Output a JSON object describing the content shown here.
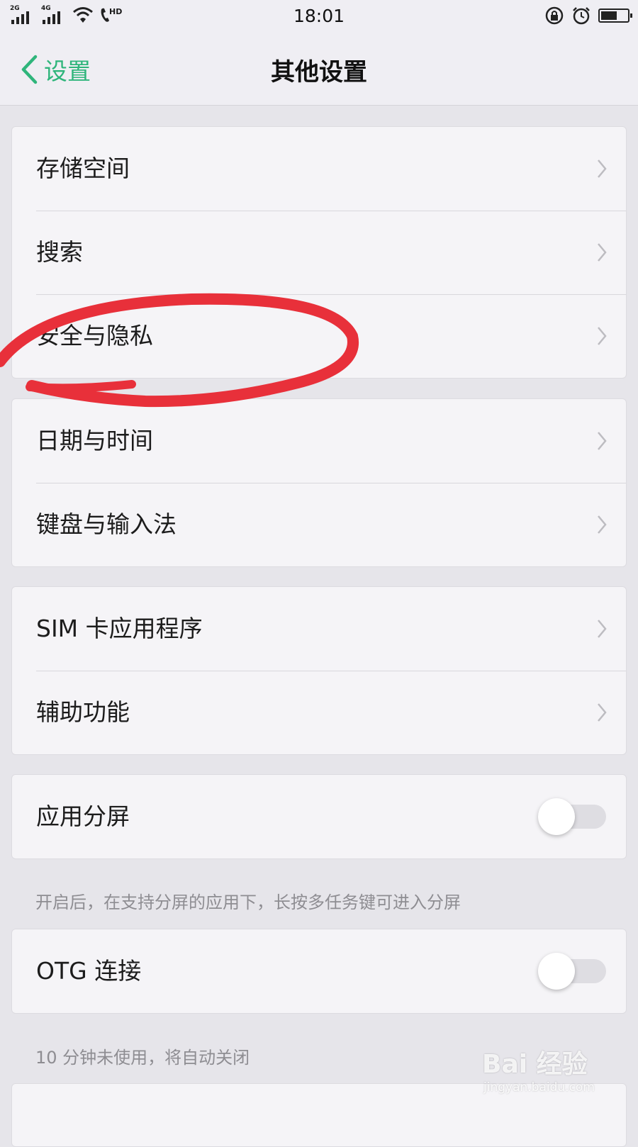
{
  "status_bar": {
    "time": "18:01",
    "sim1_label": "2G",
    "sim2_label": "4G",
    "call_badge": "HD",
    "icons": [
      "signal-icon",
      "signal-icon",
      "wifi-icon",
      "hd-call-icon",
      "rotation-lock-icon",
      "alarm-icon",
      "battery-icon"
    ],
    "battery_level": 0.6
  },
  "nav": {
    "back_label": "设置",
    "title": "其他设置",
    "accent": "#2fb57b"
  },
  "groups": [
    {
      "rows": [
        {
          "label": "存储空间"
        },
        {
          "label": "搜索"
        },
        {
          "label": "安全与隐私"
        }
      ]
    },
    {
      "rows": [
        {
          "label": "日期与时间"
        },
        {
          "label": "键盘与输入法"
        }
      ]
    },
    {
      "rows": [
        {
          "label": "SIM 卡应用程序"
        },
        {
          "label": "辅助功能"
        }
      ]
    },
    {
      "rows": [
        {
          "label": "应用分屏",
          "toggle": false
        }
      ],
      "note": "开启后，在支持分屏的应用下，长按多任务键可进入分屏"
    },
    {
      "rows": [
        {
          "label": "OTG 连接",
          "toggle": false
        }
      ],
      "note": "10 分钟未使用，将自动关闭"
    }
  ],
  "annotation_color": "#e8303a",
  "watermark": {
    "brand": "Bai 经验",
    "url": "jingyan.baidu.com"
  }
}
